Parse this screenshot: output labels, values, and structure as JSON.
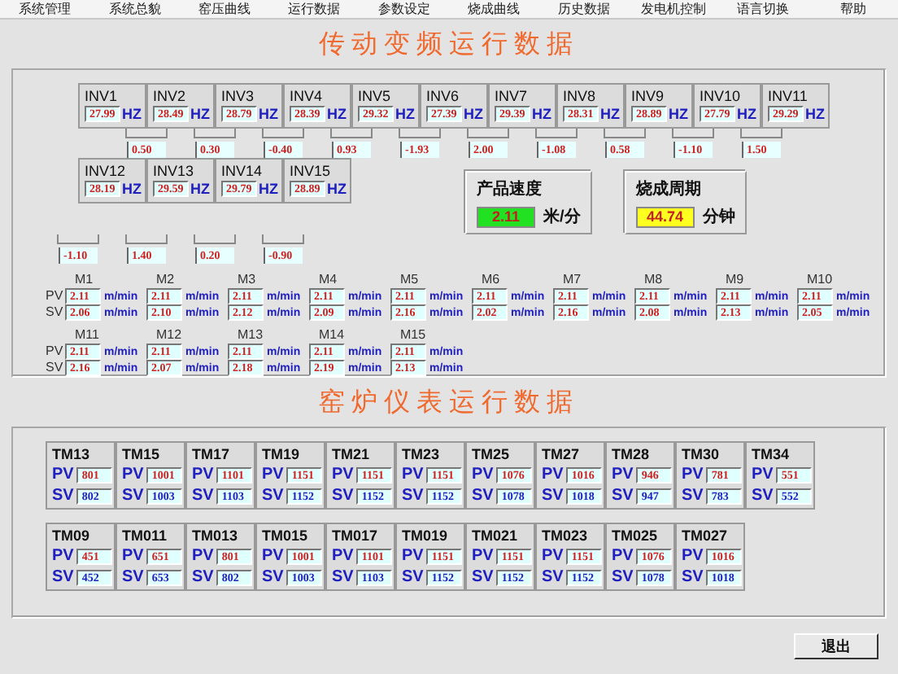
{
  "menu": [
    {
      "label": "系统管理"
    },
    {
      "label": "系统总貌"
    },
    {
      "label": "窑压曲线"
    },
    {
      "label": "运行数据"
    },
    {
      "label": "参数设定"
    },
    {
      "label": "烧成曲线"
    },
    {
      "label": "历史数据"
    },
    {
      "label": "发电机控制"
    },
    {
      "label": "语言切换"
    },
    {
      "label": "帮助"
    }
  ],
  "drive_title": "传动变频运行数据",
  "inverter_rows": [
    {
      "inverters": [
        {
          "name": "INV1",
          "value": "27.99",
          "unit": "HZ"
        },
        {
          "name": "INV2",
          "value": "28.49",
          "unit": "HZ"
        },
        {
          "name": "INV3",
          "value": "28.79",
          "unit": "HZ"
        },
        {
          "name": "INV4",
          "value": "28.39",
          "unit": "HZ"
        },
        {
          "name": "INV5",
          "value": "29.32",
          "unit": "HZ"
        },
        {
          "name": "INV6",
          "value": "27.39",
          "unit": "HZ"
        },
        {
          "name": "INV7",
          "value": "29.39",
          "unit": "HZ"
        },
        {
          "name": "INV8",
          "value": "28.31",
          "unit": "HZ"
        },
        {
          "name": "INV9",
          "value": "28.89",
          "unit": "HZ"
        },
        {
          "name": "INV10",
          "value": "27.79",
          "unit": "HZ"
        },
        {
          "name": "INV11",
          "value": "29.29",
          "unit": "HZ"
        }
      ],
      "diffs": [
        "0.50",
        "0.30",
        "-0.40",
        "0.93",
        "-1.93",
        "2.00",
        "-1.08",
        "0.58",
        "-1.10",
        "1.50"
      ]
    },
    {
      "inverters": [
        {
          "name": "INV12",
          "value": "28.19",
          "unit": "HZ"
        },
        {
          "name": "INV13",
          "value": "29.59",
          "unit": "HZ"
        },
        {
          "name": "INV14",
          "value": "29.79",
          "unit": "HZ"
        },
        {
          "name": "INV15",
          "value": "28.89",
          "unit": "HZ"
        }
      ],
      "diffs": [
        "-1.10",
        "1.40",
        "0.20",
        "-0.90"
      ]
    }
  ],
  "product_speed": {
    "label": "产品速度",
    "value": "2.11",
    "unit": "米/分"
  },
  "firing_cycle": {
    "label": "烧成周期",
    "value": "44.74",
    "unit": "分钟"
  },
  "motor_rows": [
    {
      "pv_label": "PV",
      "sv_label": "SV",
      "motors": [
        {
          "name": "M1",
          "pv": "2.11",
          "sv": "2.06",
          "pv_unit": "m/min",
          "sv_unit": "m/min"
        },
        {
          "name": "M2",
          "pv": "2.11",
          "sv": "2.10",
          "pv_unit": "m/min",
          "sv_unit": "m/min"
        },
        {
          "name": "M3",
          "pv": "2.11",
          "sv": "2.12",
          "pv_unit": "m/min",
          "sv_unit": "m/min"
        },
        {
          "name": "M4",
          "pv": "2.11",
          "sv": "2.09",
          "pv_unit": "m/min",
          "sv_unit": "m/min"
        },
        {
          "name": "M5",
          "pv": "2.11",
          "sv": "2.16",
          "pv_unit": "m/min",
          "sv_unit": "m/min"
        },
        {
          "name": "M6",
          "pv": "2.11",
          "sv": "2.02",
          "pv_unit": "m/min",
          "sv_unit": "m/min"
        },
        {
          "name": "M7",
          "pv": "2.11",
          "sv": "2.16",
          "pv_unit": "m/min",
          "sv_unit": "m/min"
        },
        {
          "name": "M8",
          "pv": "2.11",
          "sv": "2.08",
          "pv_unit": "m/min",
          "sv_unit": "m/min"
        },
        {
          "name": "M9",
          "pv": "2.11",
          "sv": "2.13",
          "pv_unit": "m/min",
          "sv_unit": "m/min"
        },
        {
          "name": "M10",
          "pv": "2.11",
          "sv": "2.05",
          "pv_unit": "m/min",
          "sv_unit": "m/min"
        }
      ]
    },
    {
      "pv_label": "PV",
      "sv_label": "SV",
      "motors": [
        {
          "name": "M11",
          "pv": "2.11",
          "sv": "2.16",
          "pv_unit": "m/min",
          "sv_unit": "m/min"
        },
        {
          "name": "M12",
          "pv": "2.11",
          "sv": "2.07",
          "pv_unit": "m/min",
          "sv_unit": "m/min"
        },
        {
          "name": "M13",
          "pv": "2.11",
          "sv": "2.18",
          "pv_unit": "m/min",
          "sv_unit": "m/min"
        },
        {
          "name": "M14",
          "pv": "2.11",
          "sv": "2.19",
          "pv_unit": "m/min",
          "sv_unit": "m/min"
        },
        {
          "name": "M15",
          "pv": "2.11",
          "sv": "2.13",
          "pv_unit": "m/min",
          "sv_unit": "m/min"
        }
      ]
    }
  ],
  "kiln_title": "窑炉仪表运行数据",
  "meter_rows": [
    {
      "meters": [
        {
          "name": "TM13",
          "pv_label": "PV",
          "pv": "801",
          "sv_label": "SV",
          "sv": "802"
        },
        {
          "name": "TM15",
          "pv_label": "PV",
          "pv": "1001",
          "sv_label": "SV",
          "sv": "1003"
        },
        {
          "name": "TM17",
          "pv_label": "PV",
          "pv": "1101",
          "sv_label": "SV",
          "sv": "1103"
        },
        {
          "name": "TM19",
          "pv_label": "PV",
          "pv": "1151",
          "sv_label": "SV",
          "sv": "1152"
        },
        {
          "name": "TM21",
          "pv_label": "PV",
          "pv": "1151",
          "sv_label": "SV",
          "sv": "1152"
        },
        {
          "name": "TM23",
          "pv_label": "PV",
          "pv": "1151",
          "sv_label": "SV",
          "sv": "1152"
        },
        {
          "name": "TM25",
          "pv_label": "PV",
          "pv": "1076",
          "sv_label": "SV",
          "sv": "1078"
        },
        {
          "name": "TM27",
          "pv_label": "PV",
          "pv": "1016",
          "sv_label": "SV",
          "sv": "1018"
        },
        {
          "name": "TM28",
          "pv_label": "PV",
          "pv": "946",
          "sv_label": "SV",
          "sv": "947"
        },
        {
          "name": "TM30",
          "pv_label": "PV",
          "pv": "781",
          "sv_label": "SV",
          "sv": "783"
        },
        {
          "name": "TM34",
          "pv_label": "PV",
          "pv": "551",
          "sv_label": "SV",
          "sv": "552"
        }
      ]
    },
    {
      "meters": [
        {
          "name": "TM09",
          "pv_label": "PV",
          "pv": "451",
          "sv_label": "SV",
          "sv": "452"
        },
        {
          "name": "TM011",
          "pv_label": "PV",
          "pv": "651",
          "sv_label": "SV",
          "sv": "653"
        },
        {
          "name": "TM013",
          "pv_label": "PV",
          "pv": "801",
          "sv_label": "SV",
          "sv": "802"
        },
        {
          "name": "TM015",
          "pv_label": "PV",
          "pv": "1001",
          "sv_label": "SV",
          "sv": "1003"
        },
        {
          "name": "TM017",
          "pv_label": "PV",
          "pv": "1101",
          "sv_label": "SV",
          "sv": "1103"
        },
        {
          "name": "TM019",
          "pv_label": "PV",
          "pv": "1151",
          "sv_label": "SV",
          "sv": "1152"
        },
        {
          "name": "TM021",
          "pv_label": "PV",
          "pv": "1151",
          "sv_label": "SV",
          "sv": "1152"
        },
        {
          "name": "TM023",
          "pv_label": "PV",
          "pv": "1151",
          "sv_label": "SV",
          "sv": "1152"
        },
        {
          "name": "TM025",
          "pv_label": "PV",
          "pv": "1076",
          "sv_label": "SV",
          "sv": "1078"
        },
        {
          "name": "TM027",
          "pv_label": "PV",
          "pv": "1016",
          "sv_label": "SV",
          "sv": "1018"
        }
      ]
    }
  ],
  "exit_button": "退出"
}
